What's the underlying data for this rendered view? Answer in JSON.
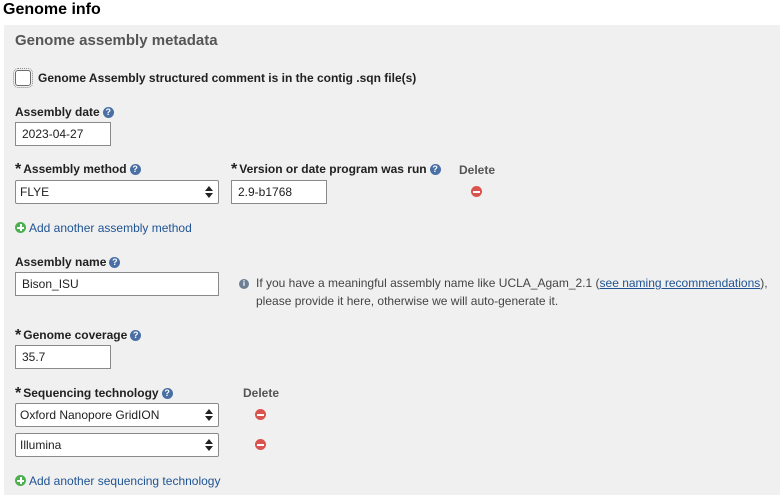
{
  "page_title": "Genome info",
  "section_title": "Genome assembly metadata",
  "structured_comment": {
    "label": "Genome Assembly structured comment is in the contig .sqn file(s)",
    "checked": false
  },
  "assembly_date": {
    "label": "Assembly date",
    "value": "2023-04-27"
  },
  "assembly_method": {
    "label": "Assembly method",
    "selected": "FLYE",
    "version_label": "Version or date program was run",
    "version_value": "2.9-b1768",
    "delete_label": "Delete",
    "add_label": "Add another assembly method"
  },
  "assembly_name": {
    "label": "Assembly name",
    "value": "Bison_ISU",
    "info_prefix": "If you have a meaningful assembly name like UCLA_Agam_2.1 (",
    "info_link": "see naming recommendations",
    "info_suffix": "), please provide it here, otherwise we will auto-generate it."
  },
  "genome_coverage": {
    "label": "Genome coverage",
    "value": "35.7"
  },
  "sequencing_technology": {
    "label": "Sequencing technology",
    "delete_label": "Delete",
    "selected": [
      "Oxford Nanopore GridION",
      "Illumina"
    ],
    "add_label": "Add another sequencing technology"
  },
  "icons": {
    "help": "question-circle-icon",
    "info": "info-circle-icon",
    "remove": "minus-circle-icon",
    "add": "plus-circle-icon"
  }
}
